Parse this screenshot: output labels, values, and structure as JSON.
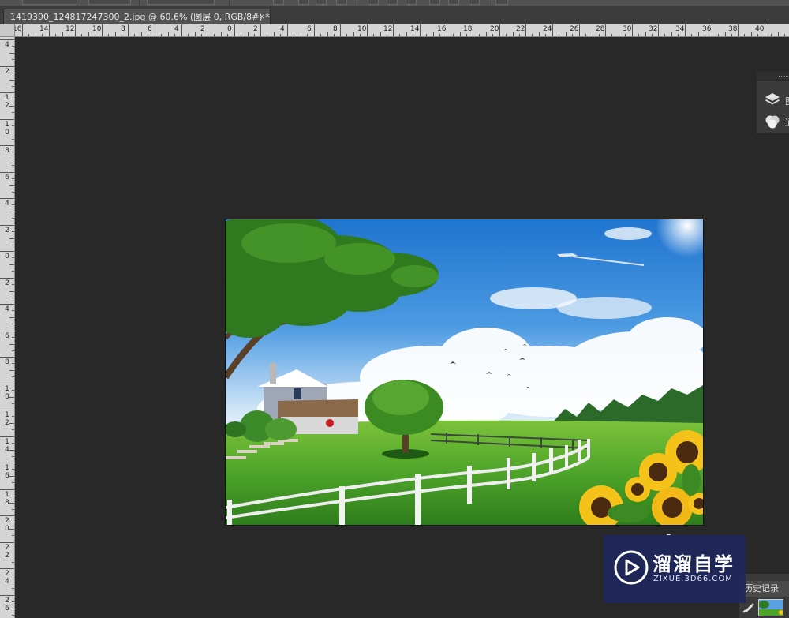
{
  "document_tab": {
    "title": "1419390_124817247300_2.jpg @ 60.6% (图层 0, RGB/8#) *",
    "close_glyph": "×"
  },
  "ruler_horizontal": [
    "16",
    "14",
    "12",
    "10",
    "8",
    "6",
    "4",
    "2",
    "0",
    "2",
    "4",
    "6",
    "8",
    "10",
    "12",
    "14",
    "16",
    "18",
    "20",
    "22",
    "24",
    "26",
    "28",
    "30",
    "32",
    "34",
    "36",
    "38",
    "40"
  ],
  "ruler_vertical": [
    "4",
    "2",
    "1|2",
    "1|0",
    "8",
    "6",
    "4",
    "2",
    "0",
    "2",
    "4",
    "6",
    "8",
    "1|0",
    "1|2",
    "1|4",
    "1|6",
    "1|8",
    "2|0",
    "2|2",
    "2|4",
    "2|6",
    "2|8"
  ],
  "panels": {
    "layers": {
      "label": "图",
      "icon": "layers-icon"
    },
    "channels": {
      "label": "通",
      "icon": "channels-icon"
    }
  },
  "history_panel": {
    "tab_label": "历史记录",
    "icon": "history-brush-icon"
  },
  "watermark": {
    "title": "溜溜自学",
    "url": "ZIXUE.3D66.COM"
  },
  "colors": {
    "workspace": "#282828",
    "panel": "#3a3a3a",
    "ruler": "#d4d4d4",
    "watermark_bg": "#1e285c"
  }
}
